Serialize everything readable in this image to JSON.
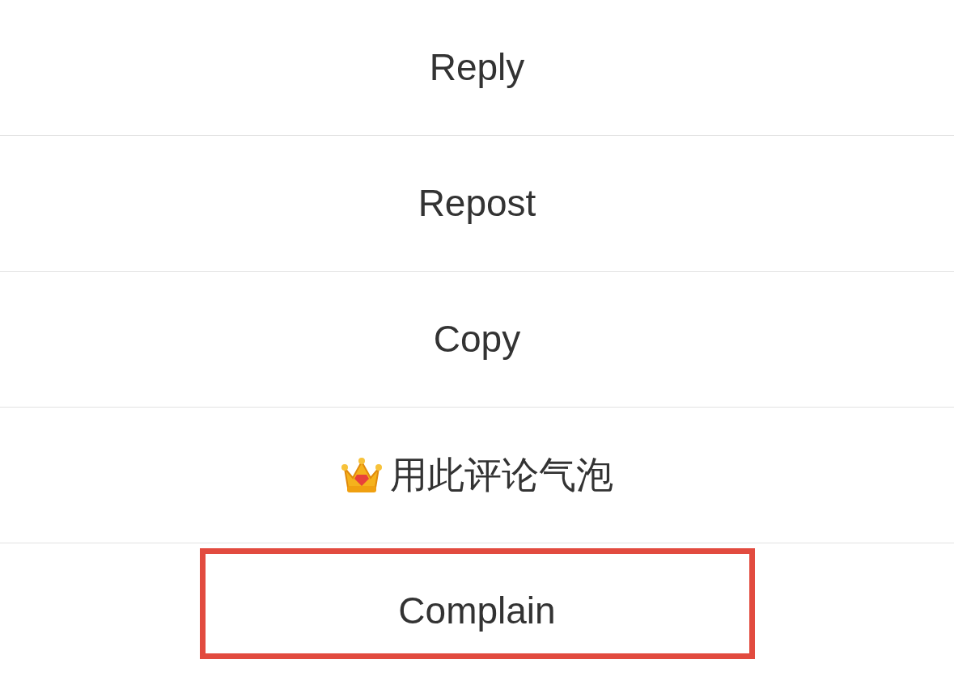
{
  "menu": [
    {
      "label": "Reply",
      "kind": "text",
      "highlighted": false
    },
    {
      "label": "Repost",
      "kind": "text",
      "highlighted": false
    },
    {
      "label": "Copy",
      "kind": "text",
      "highlighted": false
    },
    {
      "label": "用此评论气泡",
      "kind": "crown",
      "highlighted": false
    },
    {
      "label": "Complain",
      "kind": "text",
      "highlighted": true
    }
  ]
}
